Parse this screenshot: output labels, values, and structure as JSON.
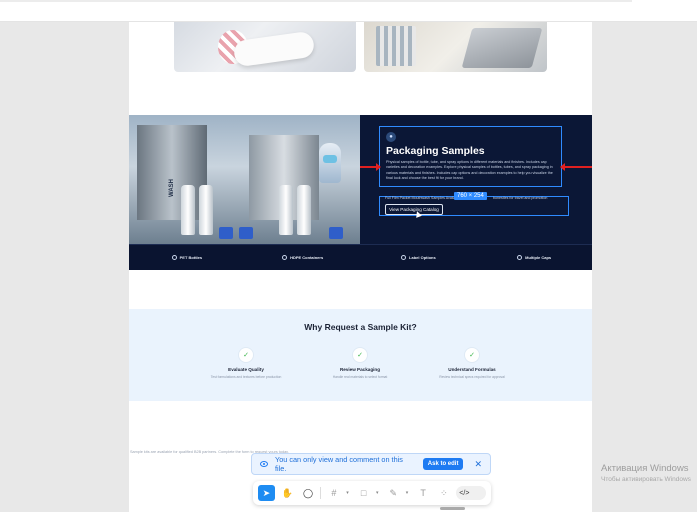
{
  "banner": {
    "title": "Packaging Samples",
    "description": "Physical samples of bottle, tube, and spray options in different materials and finishes. Includes cap varieties and decoration examples. Explore physical samples of bottles, tubes, and spray packaging in various materials and finishes. Includes cap options and decoration examples to help you visualize the final look and choose the best fit for your brand.",
    "selection_text_left": "Full Film Packet Mouthwash Samples Available",
    "selection_text_right": "bonestles for travel and promotion",
    "dimension_badge": "760 × 254",
    "catalog_button": "View Packaging Catalog",
    "bottle_label": "WASH"
  },
  "features": [
    {
      "label": "PET Bottles"
    },
    {
      "label": "HDPE Containers"
    },
    {
      "label": "Label Options"
    },
    {
      "label": "Multiple Caps"
    }
  ],
  "why": {
    "title": "Why Request a Sample Kit?",
    "items": [
      {
        "title": "Evaluate Quality",
        "sub": "Test formulations and textures before production"
      },
      {
        "title": "Review Packaging",
        "sub": "Handle real materials to select format"
      },
      {
        "title": "Understand Formulas",
        "sub": "Review technical specs required for approval"
      }
    ]
  },
  "below_text": "Sample kits are available for qualified B2B partners. Complete the form to request yours today.",
  "notice": {
    "message": "You can only view and comment on this file.",
    "ask_button": "Ask to edit",
    "close_glyph": "✕"
  },
  "toolbar": {
    "icons": [
      "cursor-icon",
      "hand-icon",
      "comment-icon",
      "frame-icon",
      "rectangle-icon",
      "pen-icon",
      "text-icon",
      "components-icon",
      "dev-mode-icon"
    ]
  },
  "windows_activation": {
    "title": "Активация Windows",
    "subtitle": "Чтобы активировать Windows"
  }
}
